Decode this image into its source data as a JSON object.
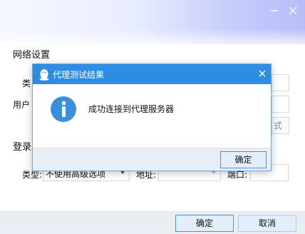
{
  "background_window": {
    "network_section_title": "网络设置",
    "type_label_partial": "类",
    "user_label_partial": "用户",
    "test_button_partial": "式",
    "login_section_title_partial": "登录",
    "login_proxy": {
      "type_label": "类型:",
      "type_value": "不使用高级选项",
      "address_label": "地址:",
      "port_label": "端口:"
    },
    "footer": {
      "ok_label": "确定",
      "cancel_label": "取消"
    }
  },
  "dialog": {
    "title": "代理测试结果",
    "message": "成功连接到代理服务器",
    "ok_label": "确定",
    "title_bar_color": "#2d8de3",
    "icon": "info-icon"
  },
  "icons": {
    "close": "close-icon",
    "minimize": "minimize-icon",
    "logo": "qq-penguin-icon"
  }
}
